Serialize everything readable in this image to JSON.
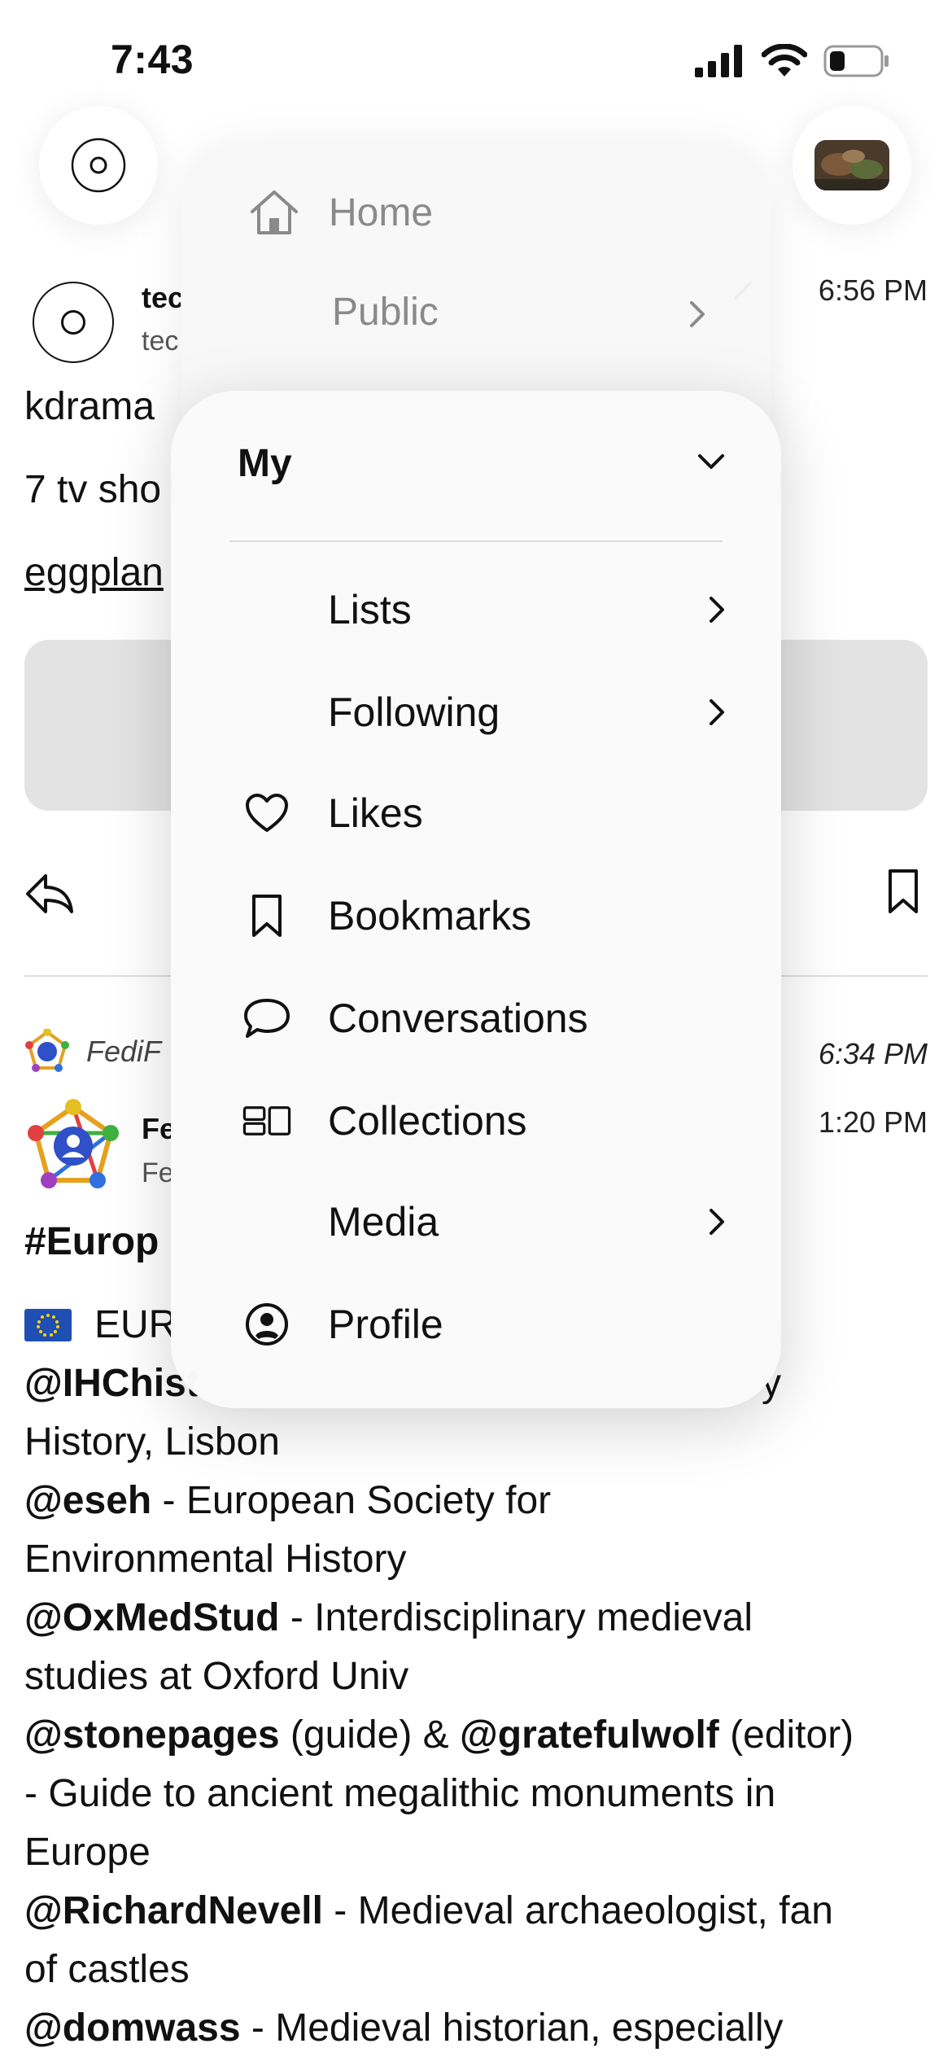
{
  "status_bar": {
    "time": "7:43"
  },
  "menu": {
    "top_items": [
      {
        "label": "Home",
        "icon": "home-icon"
      },
      {
        "label": "Public",
        "icon": "chevron-right-icon"
      }
    ],
    "section_title": "My",
    "items": [
      {
        "label": "Lists",
        "icon": "",
        "has_chevron": true
      },
      {
        "label": "Following",
        "icon": "",
        "has_chevron": true
      },
      {
        "label": "Likes",
        "icon": "heart-icon",
        "has_chevron": false
      },
      {
        "label": "Bookmarks",
        "icon": "bookmark-icon",
        "has_chevron": false
      },
      {
        "label": "Conversations",
        "icon": "chat-bubble-icon",
        "has_chevron": false
      },
      {
        "label": "Collections",
        "icon": "collections-icon",
        "has_chevron": false
      },
      {
        "label": "Media",
        "icon": "",
        "has_chevron": true
      },
      {
        "label": "Profile",
        "icon": "profile-icon",
        "has_chevron": false
      }
    ]
  },
  "timeline": {
    "post1": {
      "name_partial": "tec",
      "handle_partial": "tec",
      "time": "6:56 PM",
      "line1": "kdrama",
      "line2": "7 tv sho",
      "link": "eggplan"
    },
    "boost": {
      "by_partial": "FediF",
      "time": "6:34 PM"
    },
    "post2": {
      "name_partial": "Fe",
      "handle_partial": "Fe",
      "time": "1:20 PM",
      "hashtag_partial": "#Europ",
      "eur_line": "EUR",
      "lines": [
        {
          "mention": "@IHChist",
          "text": "y",
          "text_partial_suffix": true
        },
        {
          "mention": "",
          "text": "History, Lisbon"
        },
        {
          "mention": "@eseh",
          "text": " - European Society for"
        },
        {
          "mention": "",
          "text": "Environmental History"
        },
        {
          "mention": "@OxMedStud",
          "text": " - Interdisciplinary medieval"
        },
        {
          "mention": "",
          "text": "studies at Oxford Univ"
        },
        {
          "mention": "@stonepages",
          "text": " (guide) & ",
          "mention2": "@gratefulwolf",
          "text2": " (editor)"
        },
        {
          "mention": "",
          "text": "- Guide to ancient megalithic monuments in"
        },
        {
          "mention": "",
          "text": "Europe"
        },
        {
          "mention": "@RichardNevell",
          "text": " - Medieval archaeologist, fan"
        },
        {
          "mention": "",
          "text": "of castles"
        },
        {
          "mention": "@domwass",
          "text": " - Medieval historian, especially"
        }
      ]
    }
  }
}
